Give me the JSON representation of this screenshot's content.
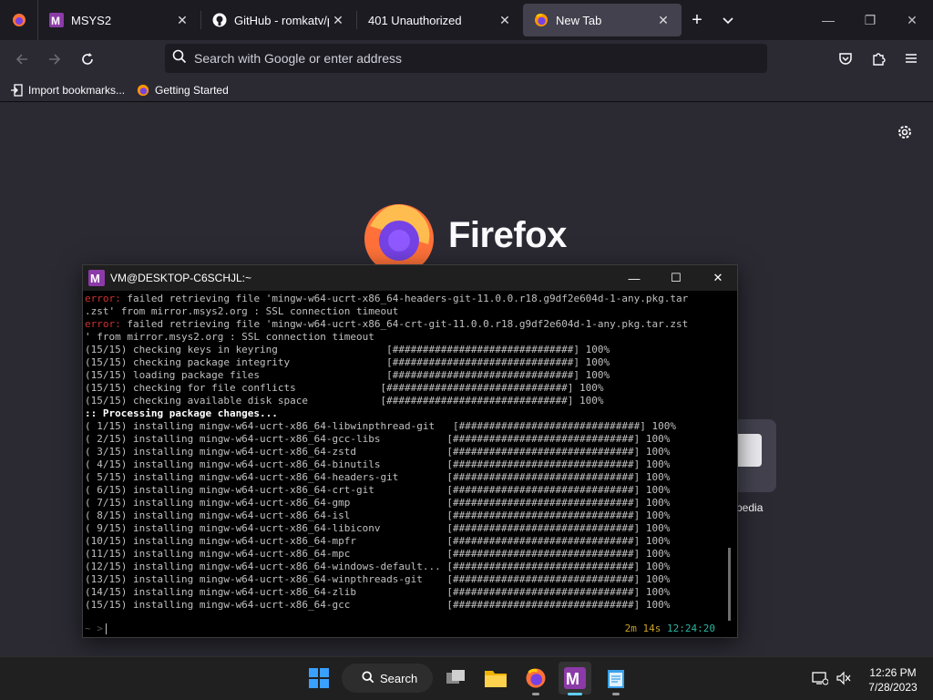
{
  "browser": {
    "tabs": [
      {
        "label": "MSYS2",
        "active": false
      },
      {
        "label": "GitHub - romkatv/pow",
        "active": false
      },
      {
        "label": "401 Unauthorized",
        "active": false
      },
      {
        "label": "New Tab",
        "active": true
      }
    ],
    "urlbar": {
      "placeholder": "Search with Google or enter address"
    },
    "bookmarks": [
      {
        "label": "Import bookmarks..."
      },
      {
        "label": "Getting Started"
      }
    ],
    "newtab": {
      "wordmark": "Firefox",
      "topsite_label": "pedia"
    }
  },
  "terminal": {
    "title": "VM@DESKTOP-C6SCHJL:~",
    "lines": [
      {
        "kind": "err",
        "prefix": "error:",
        "text": " failed retrieving file 'mingw-w64-ucrt-x86_64-headers-git-11.0.0.r18.g9df2e604d-1-any.pkg.tar"
      },
      {
        "kind": "plain",
        "prefix": "",
        "text": ".zst' from mirror.msys2.org : SSL connection timeout"
      },
      {
        "kind": "err",
        "prefix": "error:",
        "text": " failed retrieving file 'mingw-w64-ucrt-x86_64-crt-git-11.0.0.r18.g9df2e604d-1-any.pkg.tar.zst"
      },
      {
        "kind": "plain",
        "prefix": "",
        "text": "' from mirror.msys2.org : SSL connection timeout"
      },
      {
        "kind": "plain",
        "prefix": "",
        "text": "(15/15) checking keys in keyring                  [##############################] 100%"
      },
      {
        "kind": "plain",
        "prefix": "",
        "text": "(15/15) checking package integrity                [##############################] 100%"
      },
      {
        "kind": "plain",
        "prefix": "",
        "text": "(15/15) loading package files                     [##############################] 100%"
      },
      {
        "kind": "plain",
        "prefix": "",
        "text": "(15/15) checking for file conflicts              [##############################] 100%"
      },
      {
        "kind": "plain",
        "prefix": "",
        "text": "(15/15) checking available disk space            [##############################] 100%"
      },
      {
        "kind": "bold",
        "prefix": "",
        "text": ":: Processing package changes..."
      },
      {
        "kind": "plain",
        "prefix": "",
        "text": "( 1/15) installing mingw-w64-ucrt-x86_64-libwinpthread-git   [##############################] 100%"
      },
      {
        "kind": "plain",
        "prefix": "",
        "text": "( 2/15) installing mingw-w64-ucrt-x86_64-gcc-libs           [##############################] 100%"
      },
      {
        "kind": "plain",
        "prefix": "",
        "text": "( 3/15) installing mingw-w64-ucrt-x86_64-zstd               [##############################] 100%"
      },
      {
        "kind": "plain",
        "prefix": "",
        "text": "( 4/15) installing mingw-w64-ucrt-x86_64-binutils           [##############################] 100%"
      },
      {
        "kind": "plain",
        "prefix": "",
        "text": "( 5/15) installing mingw-w64-ucrt-x86_64-headers-git        [##############################] 100%"
      },
      {
        "kind": "plain",
        "prefix": "",
        "text": "( 6/15) installing mingw-w64-ucrt-x86_64-crt-git            [##############################] 100%"
      },
      {
        "kind": "plain",
        "prefix": "",
        "text": "( 7/15) installing mingw-w64-ucrt-x86_64-gmp                [##############################] 100%"
      },
      {
        "kind": "plain",
        "prefix": "",
        "text": "( 8/15) installing mingw-w64-ucrt-x86_64-isl                [##############################] 100%"
      },
      {
        "kind": "plain",
        "prefix": "",
        "text": "( 9/15) installing mingw-w64-ucrt-x86_64-libiconv           [##############################] 100%"
      },
      {
        "kind": "plain",
        "prefix": "",
        "text": "(10/15) installing mingw-w64-ucrt-x86_64-mpfr               [##############################] 100%"
      },
      {
        "kind": "plain",
        "prefix": "",
        "text": "(11/15) installing mingw-w64-ucrt-x86_64-mpc                [##############################] 100%"
      },
      {
        "kind": "plain",
        "prefix": "",
        "text": "(12/15) installing mingw-w64-ucrt-x86_64-windows-default... [##############################] 100%"
      },
      {
        "kind": "plain",
        "prefix": "",
        "text": "(13/15) installing mingw-w64-ucrt-x86_64-winpthreads-git    [##############################] 100%"
      },
      {
        "kind": "plain",
        "prefix": "",
        "text": "(14/15) installing mingw-w64-ucrt-x86_64-zlib               [##############################] 100%"
      },
      {
        "kind": "plain",
        "prefix": "",
        "text": "(15/15) installing mingw-w64-ucrt-x86_64-gcc                [##############################] 100%"
      }
    ],
    "prompt": "~ >",
    "status_duration": "2m 14s",
    "status_time": "12:24:20"
  },
  "taskbar": {
    "search_label": "Search",
    "clock_time": "12:26 PM",
    "clock_date": "7/28/2023"
  },
  "colors": {
    "terminal_error": "#cd3131",
    "status_yellow": "#c9a227",
    "status_green": "#2bb5a0"
  }
}
